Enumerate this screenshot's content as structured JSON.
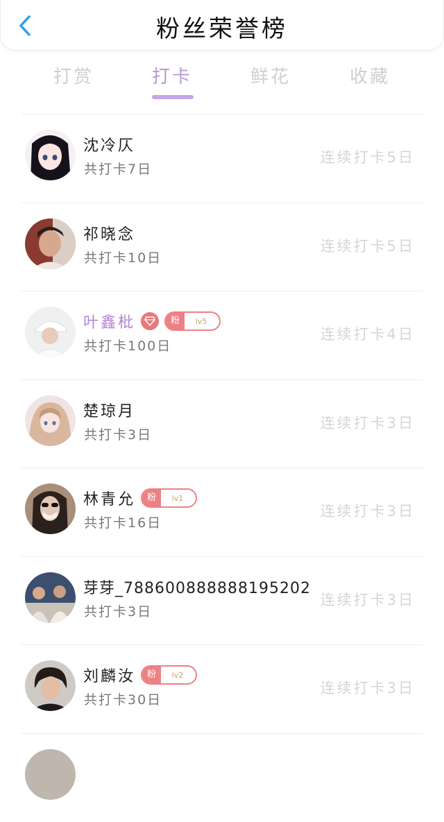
{
  "header": {
    "title": "粉丝荣誉榜"
  },
  "tabs": [
    {
      "label": "打赏",
      "active": false
    },
    {
      "label": "打卡",
      "active": true
    },
    {
      "label": "鲜花",
      "active": false
    },
    {
      "label": "收藏",
      "active": false
    }
  ],
  "colors": {
    "accent": "#c4a6e3",
    "badge": "#ec8184",
    "vip_name": "#b382d6"
  },
  "rows": [
    {
      "name": "沈冷仄",
      "total": "共打卡7日",
      "streak": "连续打卡5日",
      "avatar": "anime-girl-avatar",
      "vip": false
    },
    {
      "name": "祁晓念",
      "total": "共打卡10日",
      "streak": "连续打卡5日",
      "avatar": "boy-portrait-avatar",
      "vip": false
    },
    {
      "name": "叶鑫枇",
      "total": "共打卡100日",
      "streak": "连续打卡4日",
      "avatar": "white-cap-avatar",
      "vip": true,
      "diamond": true,
      "badge": {
        "tag": "粉",
        "level": "lv5"
      }
    },
    {
      "name": "楚琼月",
      "total": "共打卡3日",
      "streak": "连续打卡3日",
      "avatar": "anime-faded-avatar",
      "vip": false
    },
    {
      "name": "林青允",
      "total": "共打卡16日",
      "streak": "连续打卡3日",
      "avatar": "sunglasses-girl-avatar",
      "vip": false,
      "badge": {
        "tag": "粉",
        "level": "lv1"
      }
    },
    {
      "name": "芽芽_788600888888195202",
      "total": "共打卡3日",
      "streak": "连续打卡3日",
      "avatar": "group-photo-avatar",
      "vip": false
    },
    {
      "name": "刘麟汝",
      "total": "共打卡30日",
      "streak": "连续打卡3日",
      "avatar": "dark-hair-boy-avatar",
      "vip": false,
      "badge": {
        "tag": "粉",
        "level": "lv2"
      }
    }
  ]
}
